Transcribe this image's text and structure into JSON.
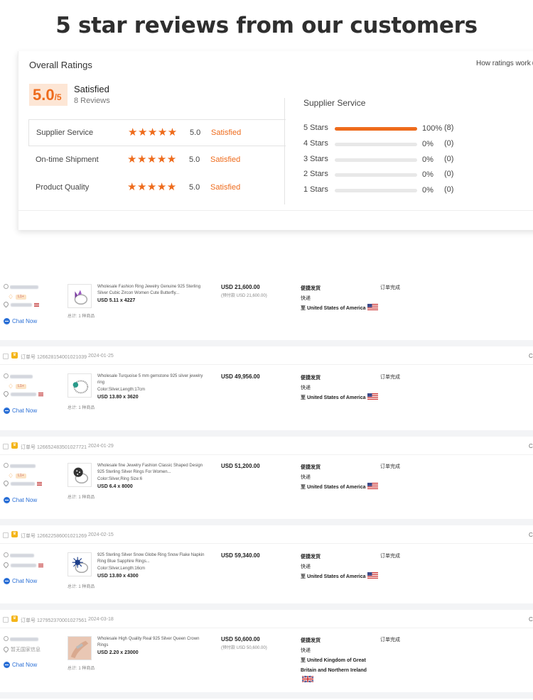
{
  "headline": "5 star reviews from our customers",
  "ratings": {
    "title": "Overall Ratings",
    "how_link": "How ratings work",
    "score_main": "5.0",
    "score_denominator": "/5",
    "satisfied": "Satisfied",
    "reviews": "8 Reviews",
    "categories": [
      {
        "label": "Supplier Service",
        "stars": "★★★★★",
        "score": "5.0",
        "status": "Satisfied"
      },
      {
        "label": "On-time Shipment",
        "stars": "★★★★★",
        "score": "5.0",
        "status": "Satisfied"
      },
      {
        "label": "Product Quality",
        "stars": "★★★★★",
        "score": "5.0",
        "status": "Satisfied"
      }
    ],
    "breakdown_title": "Supplier Service",
    "breakdown": [
      {
        "label": "5  Stars",
        "fill": 1.0,
        "pct": "100%",
        "count": "(8)"
      },
      {
        "label": "4  Stars",
        "fill": 0,
        "pct": "0%",
        "count": "(0)"
      },
      {
        "label": "3  Stars",
        "fill": 0,
        "pct": "0%",
        "count": "(0)"
      },
      {
        "label": "2  Stars",
        "fill": 0,
        "pct": "0%",
        "count": "(0)"
      },
      {
        "label": "1  Stars",
        "fill": 0,
        "pct": "0%",
        "count": "(0)"
      }
    ],
    "accent": "#ee6b1c"
  },
  "orders": [
    {
      "id": "",
      "date": "",
      "level_badge": "L1+",
      "chat": "Chat Now",
      "title": "Wholesale Fashion Ring Jewelry Genuine 925 Sterling Silver Cubic Zircon Women Cute Butterfly...",
      "variant": "",
      "price": "USD 5.11 x 4227",
      "total": "总计: 1 种商品",
      "amount": "USD 21,600.00",
      "paid": "(预付款 USD 21,600.00)",
      "ship1": "便捷发货",
      "ship2": "快递",
      "dest": "至 United States of America",
      "status": "订单完成"
    },
    {
      "id": "订单号 126628154001021039",
      "date": "2024-01-25",
      "level_badge": "L1+",
      "chat": "Chat Now",
      "title": "Wholesale Turquoise 5 mm gemstone 925 silver jewelry ring",
      "variant": "Color:Silver,Length:17cm",
      "price": "USD 13.80 x 3620",
      "total": "总计: 1 种商品",
      "amount": "USD 49,956.00",
      "paid": "",
      "ship1": "便捷发货",
      "ship2": "快递",
      "dest": "至 United States of America",
      "status": "订单完成"
    },
    {
      "id": "订单号 126652483501027721",
      "date": "2024-01-29",
      "level_badge": "L1+",
      "chat": "Chat Now",
      "title": "Wholesale fine Jewelry Fashion Classic Shaped Design 925 Sterling Silver Rings For Women...",
      "variant": "Color:Silver,Ring Size:6",
      "price": "USD 6.4 x 8000",
      "total": "总计: 1 种商品",
      "amount": "USD 51,200.00",
      "paid": "",
      "ship1": "便捷发货",
      "ship2": "快递",
      "dest": "至 United States of America",
      "status": "订单完成"
    },
    {
      "id": "订单号 126622586001021269",
      "date": "2024-02-15",
      "level_badge": "",
      "chat": "Chat Now",
      "title": "925 Sterling Silver Snow Globe Ring Snow Flake Napkin Ring Blue Sapphire Rings...",
      "variant": "Color:Silver,Length:16cm",
      "price": "USD 13.80 x 4300",
      "total": "总计: 1 种商品",
      "amount": "USD 59,340.00",
      "paid": "",
      "ship1": "便捷发货",
      "ship2": "快递",
      "dest": "至 United States of America",
      "status": "订单完成"
    },
    {
      "id": "订单号 127952370001027561",
      "date": "2024-03-18",
      "level_badge": "",
      "location_text": "暂无国家信息",
      "chat": "Chat Now",
      "title": "Wholesale High Quality Real 925 Silver Queen Crown Rings",
      "variant": "",
      "price": "USD 2.20 x 23000",
      "total": "总计: 1 种商品",
      "amount": "USD 50,600.00",
      "paid": "(预付款 USD 50,600.00)",
      "ship1": "便捷发货",
      "ship2": "快递",
      "dest": "至 United Kingdom of Great Britain and Northern Ireland",
      "status": "订单完成"
    }
  ],
  "edge_cut": "Cl"
}
